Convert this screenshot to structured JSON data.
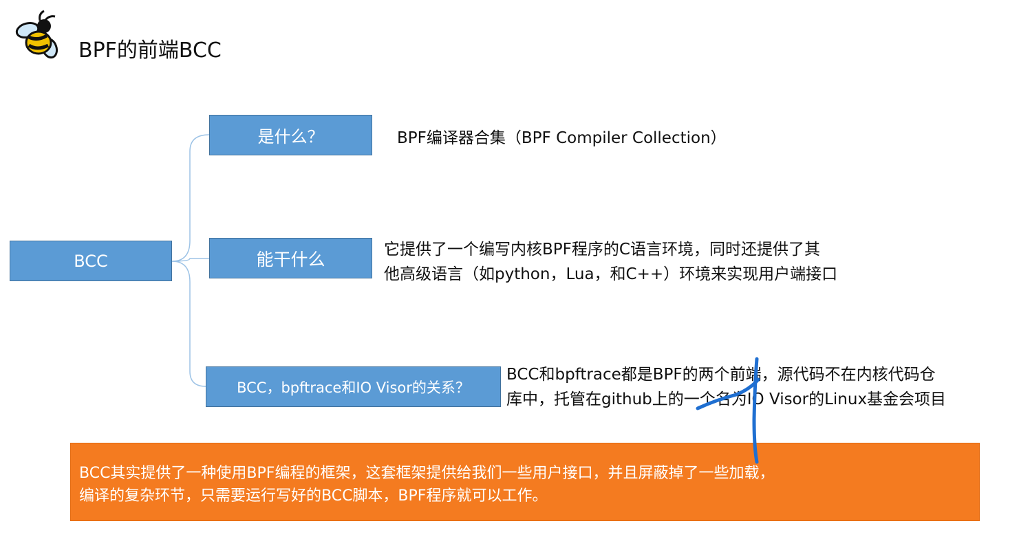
{
  "slide": {
    "title": "BPF的前端BCC",
    "logo_icon": "bee-icon"
  },
  "mindmap": {
    "root": {
      "label": "BCC"
    },
    "branches": [
      {
        "label": "是什么？",
        "description_lines": [
          "BPF编译器合集（BPF Compiler Collection）"
        ]
      },
      {
        "label": "能干什么",
        "description_lines": [
          "它提供了一个编写内核BPF程序的C语言环境，同时还提供了其",
          "他高级语言（如python，Lua，和C++）环境来实现用户端接口"
        ]
      },
      {
        "label": "BCC，bpftrace和IO Visor的关系？",
        "description_lines": [
          "BCC和bpftrace都是BPF的两个前端，源代码不在内核代码仓",
          "库中，托管在github上的一个名为IO Visor的Linux基金会项目"
        ]
      }
    ]
  },
  "callout": {
    "lines": [
      "BCC其实提供了一种使用BPF编程的框架，这套框架提供给我们一些用户接口，并且屏蔽掉了一些加载，",
      "编译的复杂环节，只需要运行写好的BCC脚本，BPF程序就可以工作。"
    ]
  },
  "colors": {
    "box_fill": "#5b9bd5",
    "box_border": "#41719c",
    "callout_fill": "#f47b20",
    "connector": "#9dc3e6",
    "pen_annotation": "#1f6fd1"
  }
}
